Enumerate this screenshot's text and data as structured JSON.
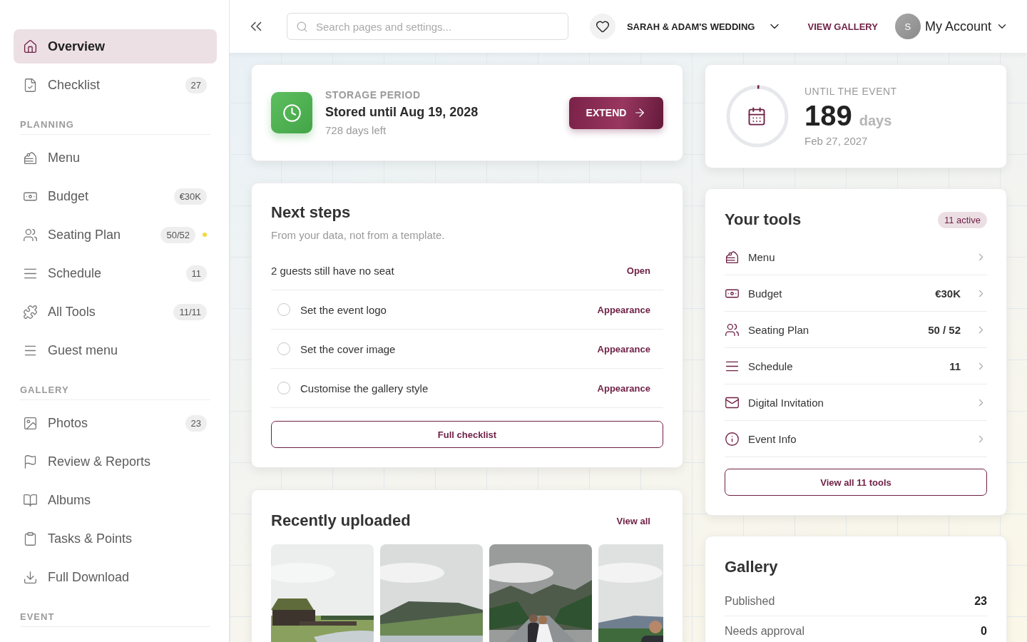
{
  "sidebar": {
    "items": [
      {
        "label": "Overview",
        "selected": true,
        "warning": false
      },
      {
        "label": "Checklist",
        "badge": "27",
        "selected": false,
        "warning": false
      }
    ],
    "sections": [
      {
        "title": "PLANNING",
        "items": [
          {
            "label": "Menu",
            "selected": false,
            "warning": false
          },
          {
            "label": "Budget",
            "badge": "€30K",
            "selected": false,
            "warning": false
          },
          {
            "label": "Seating Plan",
            "badge": "50/52",
            "selected": false,
            "warning": true
          },
          {
            "label": "Schedule",
            "badge": "11",
            "selected": false,
            "warning": false
          },
          {
            "label": "All Tools",
            "badge": "11/11",
            "selected": false,
            "warning": false
          },
          {
            "label": "Guest menu",
            "selected": false,
            "warning": false
          }
        ]
      },
      {
        "title": "GALLERY",
        "items": [
          {
            "label": "Photos",
            "badge": "23",
            "selected": false,
            "warning": false
          },
          {
            "label": "Review & Reports",
            "selected": false,
            "warning": false
          },
          {
            "label": "Albums",
            "selected": false,
            "warning": false
          },
          {
            "label": "Tasks & Points",
            "selected": false,
            "warning": false
          },
          {
            "label": "Full Download",
            "selected": false,
            "warning": false
          }
        ]
      },
      {
        "title": "EVENT"
      }
    ]
  },
  "topbar": {
    "search": {
      "placeholder": "Search pages and settings..."
    },
    "event_name": "SARAH & ADAM'S WEDDING",
    "view_gallery": "VIEW GALLERY",
    "account": {
      "initial": "S",
      "label": "My Account"
    }
  },
  "storage": {
    "eyebrow": "STORAGE PERIOD",
    "title": "Stored until Aug 19, 2028",
    "subtitle": "728 days left",
    "button": "EXTEND"
  },
  "countdown": {
    "eyebrow": "UNTIL THE EVENT",
    "number": "189",
    "unit": "days",
    "date": "Feb 27, 2027",
    "level": 0.01
  },
  "next_steps": {
    "title": "Next steps",
    "subtitle": "From your data, not from a template.",
    "items": [
      {
        "kind": "info",
        "label": "2 guests still have no seat",
        "action": "Open"
      },
      {
        "kind": "task",
        "label": "Set the event logo",
        "checked": false,
        "action": "Appearance"
      },
      {
        "kind": "task",
        "label": "Set the cover image",
        "checked": false,
        "action": "Appearance"
      },
      {
        "kind": "task",
        "label": "Customise the gallery style",
        "checked": false,
        "action": "Appearance"
      }
    ],
    "button": "Full checklist"
  },
  "recent": {
    "title": "Recently uploaded",
    "link": "View all"
  },
  "tools": {
    "title": "Your tools",
    "badge": "11 active",
    "items": [
      {
        "label": "Menu"
      },
      {
        "label": "Budget",
        "value": "€30K"
      },
      {
        "label": "Seating Plan",
        "value": "50 / 52"
      },
      {
        "label": "Schedule",
        "value": "11"
      },
      {
        "label": "Digital Invitation"
      },
      {
        "label": "Event Info"
      }
    ],
    "button": "View all 11 tools"
  },
  "gallery": {
    "title": "Gallery",
    "rows": [
      {
        "label": "Published",
        "value": "23"
      },
      {
        "label": "Needs approval",
        "value": "0"
      }
    ]
  }
}
